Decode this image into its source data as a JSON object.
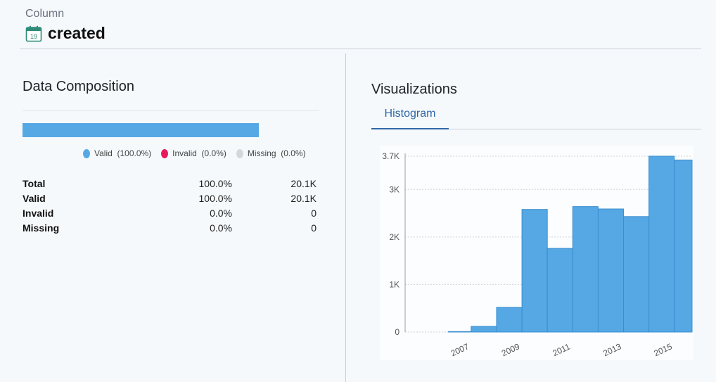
{
  "header": {
    "kicker": "Column",
    "column_name": "created",
    "icon": "calendar-icon",
    "icon_text": "19"
  },
  "composition": {
    "title": "Data Composition",
    "bar_valid_fraction": 1.0,
    "legend": [
      {
        "label": "Valid",
        "value": "(100.0%)",
        "color": "#55a8e4"
      },
      {
        "label": "Invalid",
        "value": "(0.0%)",
        "color": "#e8195a"
      },
      {
        "label": "Missing",
        "value": "(0.0%)",
        "color": "#d4d8dd"
      }
    ],
    "rows": [
      {
        "label": "Total",
        "pct": "100.0%",
        "count": "20.1K"
      },
      {
        "label": "Valid",
        "pct": "100.0%",
        "count": "20.1K"
      },
      {
        "label": "Invalid",
        "pct": "0.0%",
        "count": "0"
      },
      {
        "label": "Missing",
        "pct": "0.0%",
        "count": "0"
      }
    ]
  },
  "visualizations": {
    "title": "Visualizations",
    "tabs": [
      {
        "label": "Histogram",
        "active": true
      }
    ]
  },
  "chart_data": {
    "type": "bar",
    "title": "",
    "xlabel": "",
    "ylabel": "",
    "bar_color": "#55a8e4",
    "grid": true,
    "xlim": [
      2005.0,
      2016.3
    ],
    "ylim": [
      0,
      3700
    ],
    "bins": [
      {
        "start": 2006.7,
        "end": 2007.6,
        "value": 10
      },
      {
        "start": 2007.6,
        "end": 2008.6,
        "value": 120
      },
      {
        "start": 2008.6,
        "end": 2009.6,
        "value": 520
      },
      {
        "start": 2009.6,
        "end": 2010.6,
        "value": 2580
      },
      {
        "start": 2010.6,
        "end": 2011.6,
        "value": 1760
      },
      {
        "start": 2011.6,
        "end": 2012.6,
        "value": 2640
      },
      {
        "start": 2012.6,
        "end": 2013.6,
        "value": 2590
      },
      {
        "start": 2013.6,
        "end": 2014.6,
        "value": 2430
      },
      {
        "start": 2014.6,
        "end": 2015.6,
        "value": 3700
      },
      {
        "start": 2015.6,
        "end": 2016.3,
        "value": 3620
      }
    ],
    "x_ticks": [
      {
        "value": 2007.2,
        "label": "2007"
      },
      {
        "value": 2009.2,
        "label": "2009"
      },
      {
        "value": 2011.2,
        "label": "2011"
      },
      {
        "value": 2013.2,
        "label": "2013"
      },
      {
        "value": 2015.2,
        "label": "2015"
      }
    ],
    "y_ticks": [
      {
        "value": 0,
        "label": "0"
      },
      {
        "value": 1000,
        "label": "1K"
      },
      {
        "value": 2000,
        "label": "2K"
      },
      {
        "value": 3000,
        "label": "3K"
      },
      {
        "value": 3700,
        "label": "3.7K"
      }
    ]
  }
}
